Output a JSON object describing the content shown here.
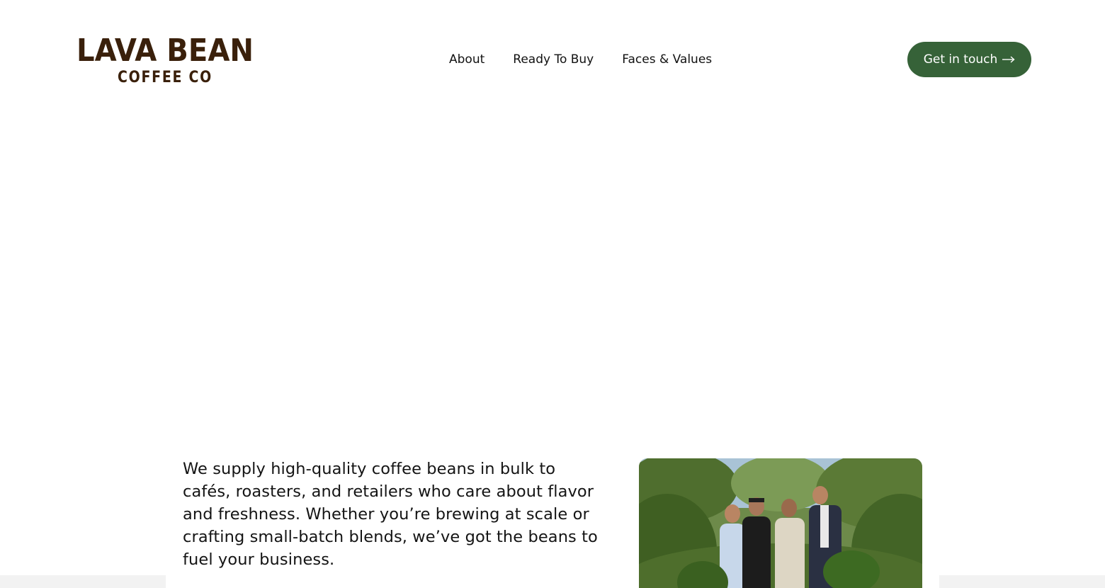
{
  "header": {
    "logo": {
      "line1": "LAVA BEAN",
      "line2": "COFFEE CO",
      "color": "#3a200b"
    },
    "nav": [
      {
        "label": "About"
      },
      {
        "label": "Ready To Buy"
      },
      {
        "label": "Faces & Values"
      }
    ],
    "cta": {
      "label": "Get in touch",
      "icon": "arrow-right-icon",
      "color": "#366238"
    }
  },
  "intro": {
    "text": "We supply high-quality coffee beans in bulk to cafés, roasters, and retailers who care about flavor and freshness. Whether you’re brewing at scale or crafting small-batch blends, we’ve got the beans to fuel your business."
  }
}
